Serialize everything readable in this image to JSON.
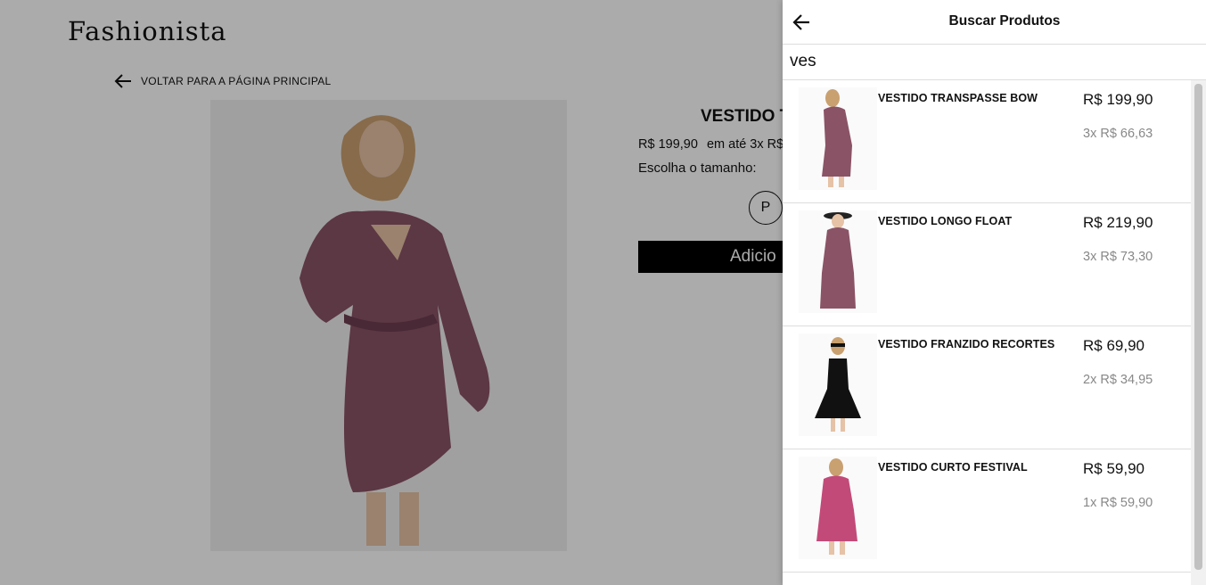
{
  "store": {
    "brand": "Fashionista",
    "back_label": "VOLTAR PARA A PÁGINA PRINCIPAL"
  },
  "product": {
    "title": "VESTIDO T",
    "price": "R$ 199,90",
    "installments": "em até 3x R$",
    "size_label": "Escolha o tamanho:",
    "size_option": "P",
    "add_button": "Adicio"
  },
  "search": {
    "title": "Buscar Produtos",
    "query": "ves",
    "results": [
      {
        "name": "VESTIDO TRANSPASSE BOW",
        "price": "R$ 199,90",
        "installments": "3x R$ 66,63"
      },
      {
        "name": "VESTIDO LONGO FLOAT",
        "price": "R$ 219,90",
        "installments": "3x R$ 73,30"
      },
      {
        "name": "VESTIDO FRANZIDO RECORTES",
        "price": "R$ 69,90",
        "installments": "2x R$ 34,95"
      },
      {
        "name": "VESTIDO CURTO FESTIVAL",
        "price": "R$ 59,90",
        "installments": "1x R$ 59,90"
      }
    ]
  },
  "colors": {
    "overlay": "#00000055",
    "button": "#000000",
    "muted_text": "#888888"
  },
  "icons": {
    "back": "arrow-left-icon"
  }
}
